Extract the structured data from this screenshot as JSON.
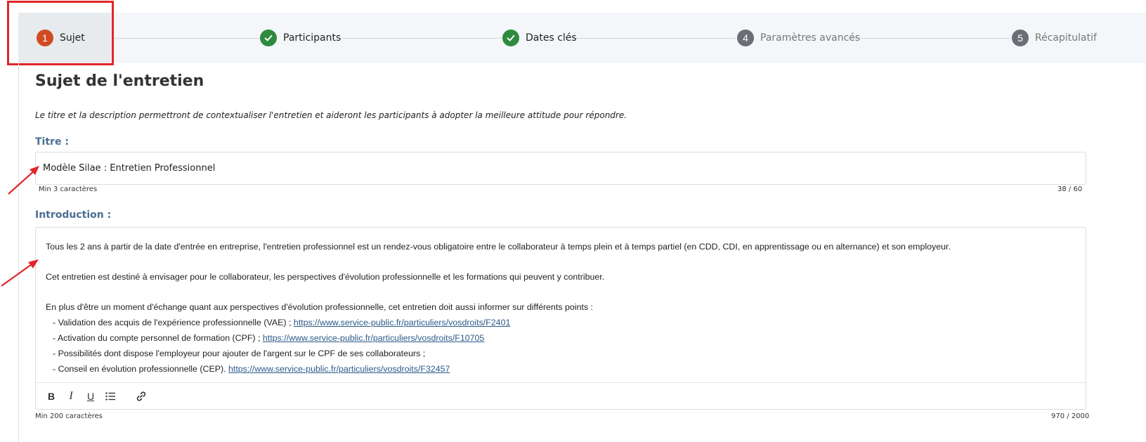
{
  "stepper": {
    "steps": [
      {
        "number": "1",
        "label": "Sujet",
        "state": "current"
      },
      {
        "number": "2",
        "label": "Participants",
        "state": "done"
      },
      {
        "number": "3",
        "label": "Dates clés",
        "state": "done"
      },
      {
        "number": "4",
        "label": "Paramètres avancés",
        "state": "todo"
      },
      {
        "number": "5",
        "label": "Récapitulatif",
        "state": "todo"
      }
    ]
  },
  "page": {
    "title": "Sujet de l'entretien",
    "helper": "Le titre et la description permettront de contextualiser l'entretien et aideront les participants à adopter la meilleure attitude pour répondre."
  },
  "title_field": {
    "label": "Titre :",
    "value": "Modèle Silae : Entretien Professionnel",
    "min_hint": "Min 3 caractères",
    "counter": "38 / 60"
  },
  "intro_field": {
    "label": "Introduction :",
    "paragraph1": "Tous les 2 ans à partir de la date d'entrée en entreprise, l'entretien professionnel est un rendez-vous obligatoire entre le collaborateur à temps plein et à temps partiel (en CDD, CDI, en apprentissage ou en alternance) et son employeur.",
    "paragraph2": "Cet entretien est destiné à envisager pour le collaborateur, les perspectives d'évolution professionnelle et les formations qui peuvent y contribuer.",
    "paragraph3": "En plus d'être un moment d'échange quant aux perspectives d'évolution professionnelle, cet entretien doit aussi informer sur différents points :",
    "bullet1_text": "- Validation des acquis de l'expérience professionnelle (VAE) ; ",
    "bullet1_link": "https://www.service-public.fr/particuliers/vosdroits/F2401",
    "bullet2_text": "- Activation du compte personnel de formation (CPF) ; ",
    "bullet2_link": "https://www.service-public.fr/particuliers/vosdroits/F10705",
    "bullet3_text": "- Possibilités dont dispose l'employeur pour ajouter de l'argent sur le CPF de ses collaborateurs ;",
    "bullet4_text": "-  Conseil en évolution professionnelle (CEP). ",
    "bullet4_link": "https://www.service-public.fr/particuliers/vosdroits/F32457",
    "toolbar": {
      "bold": "B",
      "italic": "I",
      "underline": "U"
    },
    "min_hint": "Min 200 caractères",
    "counter": "970 / 2000"
  },
  "colors": {
    "current_step": "#d14b22",
    "done_step": "#2e8b3e",
    "todo_step": "#6b6f75",
    "field_label": "#4a6f92",
    "annotation_red": "#e0262a"
  }
}
